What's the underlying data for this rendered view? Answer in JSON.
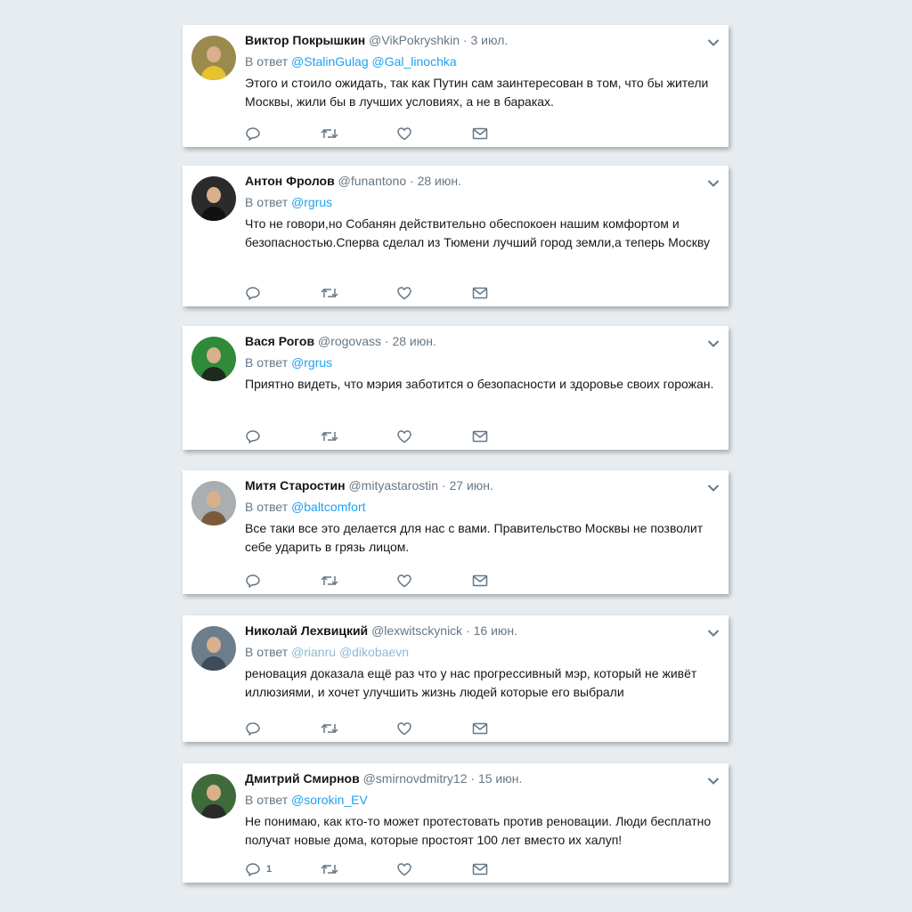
{
  "tweets": [
    {
      "name": "Виктор Покрышкин",
      "handle": "@VikPokryshkin",
      "date": "3 июл.",
      "reply_prefix": "В ответ",
      "mentions": [
        "@StalinGulag",
        "@Gal_linochka"
      ],
      "text": "Этого и стоило ожидать, так как Путин сам заинтересован в том, что бы жители Москвы, жили бы в лучших условиях, а не в бараках.",
      "avatar_bg": "#9a8a4e",
      "avatar_body": "#e6c230",
      "reply_count": ""
    },
    {
      "name": "Антон Фролов",
      "handle": "@funantono",
      "date": "28 июн.",
      "reply_prefix": "В ответ",
      "mentions": [
        "@rgrus"
      ],
      "text": "Что не говори,но Собанян действительно обеспокоен нашим комфортом и безопасностью.Сперва сделал из Тюмени лучший город земли,а теперь Москву",
      "avatar_bg": "#2b2b2b",
      "avatar_body": "#111111",
      "reply_count": ""
    },
    {
      "name": "Вася Рогов",
      "handle": "@rogovass",
      "date": "28 июн.",
      "reply_prefix": "В ответ",
      "mentions": [
        "@rgrus"
      ],
      "text": "Приятно видеть, что мэрия заботится о безопасности и здоровье своих горожан.",
      "avatar_bg": "#2f8a3a",
      "avatar_body": "#1d2a1e",
      "reply_count": ""
    },
    {
      "name": "Митя Старостин",
      "handle": "@mityastarostin",
      "date": "27 июн.",
      "reply_prefix": "В ответ",
      "mentions": [
        "@baltcomfort"
      ],
      "text": "Все таки все это делается для нас с вами. Правительство Москвы не позволит себе ударить в грязь лицом.",
      "avatar_bg": "#a9aeb0",
      "avatar_body": "#7a5a3a",
      "reply_count": ""
    },
    {
      "name": "Николай Лехвицкий",
      "handle": "@lexwitsckynick",
      "date": "16 июн.",
      "reply_prefix": "В ответ",
      "mentions": [
        "@rianru",
        "@dikobaevn"
      ],
      "mentions_muted": true,
      "text": "реновация доказала ещё раз что у нас прогрессивный мэр, который не живёт иллюзиями, и хочет улучшить жизнь людей которые его выбрали",
      "avatar_bg": "#6c7d8c",
      "avatar_body": "#3e4c5a",
      "reply_count": ""
    },
    {
      "name": "Дмитрий Смирнов",
      "handle": "@smirnovdmitry12",
      "date": "15 июн.",
      "reply_prefix": "В ответ",
      "mentions": [
        "@sorokin_EV"
      ],
      "text": "Не понимаю, как кто-то может протестовать против реновации. Люди бесплатно получат новые дома, которые простоят 100 лет вместо их халуп!",
      "avatar_bg": "#3f6a3a",
      "avatar_body": "#2a2a2a",
      "reply_count": "1"
    }
  ],
  "icons": {
    "reply": "reply-icon",
    "retweet": "retweet-icon",
    "like": "like-icon",
    "message": "direct-message-icon",
    "caret": "chevron-down-icon"
  }
}
